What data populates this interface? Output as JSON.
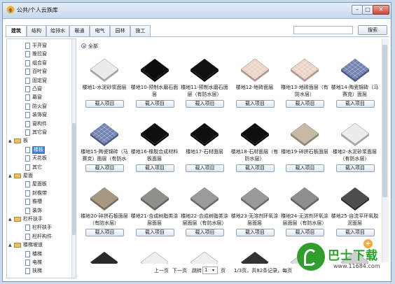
{
  "window": {
    "title": "公共/个人云族库"
  },
  "tabs": [
    "建筑",
    "结构",
    "给排水",
    "暖通",
    "电气",
    "园林",
    "施工"
  ],
  "search": {
    "placeholder": "",
    "button_label": "搜索"
  },
  "tree": [
    {
      "label": "平开窗",
      "level": 2,
      "kind": "doc",
      "expand": ""
    },
    {
      "label": "推拉窗",
      "level": 2,
      "kind": "doc",
      "expand": ""
    },
    {
      "label": "组合窗",
      "level": 2,
      "kind": "doc",
      "expand": ""
    },
    {
      "label": "百叶窗",
      "level": 2,
      "kind": "doc",
      "expand": ""
    },
    {
      "label": "固定窗",
      "level": 2,
      "kind": "doc",
      "expand": ""
    },
    {
      "label": "凸窗",
      "level": 2,
      "kind": "doc",
      "expand": ""
    },
    {
      "label": "幕窗",
      "level": 2,
      "kind": "doc",
      "expand": ""
    },
    {
      "label": "防火窗",
      "level": 2,
      "kind": "doc",
      "expand": ""
    },
    {
      "label": "装饰窗",
      "level": 2,
      "kind": "doc",
      "expand": ""
    },
    {
      "label": "窗构件",
      "level": 2,
      "kind": "doc",
      "expand": ""
    },
    {
      "label": "其它窗",
      "level": 2,
      "kind": "doc",
      "expand": ""
    },
    {
      "label": "板",
      "level": 1,
      "kind": "folder",
      "expand": "▲"
    },
    {
      "label": "楼板",
      "level": 2,
      "kind": "doc",
      "expand": "",
      "selected": true
    },
    {
      "label": "天花板",
      "level": 2,
      "kind": "doc",
      "expand": ""
    },
    {
      "label": "其它",
      "level": 2,
      "kind": "doc",
      "expand": ""
    },
    {
      "label": "屋面",
      "level": 1,
      "kind": "folder",
      "expand": "▲"
    },
    {
      "label": "屋面板",
      "level": 2,
      "kind": "doc",
      "expand": ""
    },
    {
      "label": "封檐带",
      "level": 2,
      "kind": "doc",
      "expand": ""
    },
    {
      "label": "檐槽",
      "level": 2,
      "kind": "doc",
      "expand": ""
    },
    {
      "label": "装饰",
      "level": 2,
      "kind": "doc",
      "expand": ""
    },
    {
      "label": "栏杆扶手",
      "level": 1,
      "kind": "folder",
      "expand": "▲"
    },
    {
      "label": "栏杆扶手",
      "level": 2,
      "kind": "doc",
      "expand": ""
    },
    {
      "label": "栏杆构件",
      "level": 2,
      "kind": "doc",
      "expand": ""
    },
    {
      "label": "楼梯坡道",
      "level": 1,
      "kind": "folder",
      "expand": "▲"
    },
    {
      "label": "楼梯",
      "level": 2,
      "kind": "doc",
      "expand": ""
    },
    {
      "label": "电梯",
      "level": 2,
      "kind": "doc",
      "expand": ""
    },
    {
      "label": "扶梯",
      "level": 2,
      "kind": "doc",
      "expand": ""
    }
  ],
  "filter": {
    "all_label": "全部"
  },
  "load_label": "载入项目",
  "items": [
    {
      "name": "楼地1-水泥砂浆面层",
      "top": "#ececec",
      "side": "#a9a9a9",
      "pattern": ""
    },
    {
      "name": "楼地10-预制水磨石面层",
      "top": "#0c0c0c",
      "side": "#000000",
      "pattern": ""
    },
    {
      "name": "楼地11-预制水磨石面层（有防水层）",
      "top": "#101010",
      "side": "#000000",
      "pattern": ""
    },
    {
      "name": "楼地12-地砖面层",
      "top": "#ecd2c7",
      "side": "#b39c92",
      "pattern": "grid"
    },
    {
      "name": "楼地13-地砖面层（有防水层）",
      "top": "#ecd2c7",
      "side": "#b39c92",
      "pattern": "grid"
    },
    {
      "name": "楼地14-陶瓷锦砖（马赛克）面层",
      "top": "#7283b3",
      "side": "#4a5785",
      "pattern": "grid"
    },
    {
      "name": "楼地15-陶瓷锦砖（马赛克）面层（有防水层）",
      "top": "#7283b3",
      "side": "#4a5785",
      "pattern": "grid"
    },
    {
      "name": "楼地16-橡胶合成材料板面层",
      "top": "#0f0f0f",
      "side": "#000000",
      "pattern": ""
    },
    {
      "name": "楼地17-石材面层",
      "top": "#0f0f0f",
      "side": "#000000",
      "pattern": ""
    },
    {
      "name": "楼地18-石材面层（有防水层）",
      "top": "#0f0f0f",
      "side": "#000000",
      "pattern": ""
    },
    {
      "name": "楼地19-碎拼石板面层",
      "top": "#c7b9a6",
      "side": "#948676",
      "pattern": ""
    },
    {
      "name": "楼地2-水泥砂浆面层（有防水层）",
      "top": "#ececec",
      "side": "#a9a9a9",
      "pattern": ""
    },
    {
      "name": "楼地20-碎拼石板面层（有防水层）",
      "top": "#a79882",
      "side": "#776a58",
      "pattern": ""
    },
    {
      "name": "楼地21-合成树脂类涂层面层",
      "top": "#8e9189",
      "side": "#5f625a",
      "pattern": ""
    },
    {
      "name": "楼地22-合成树脂类涂层面层（有防水层）",
      "top": "#9a9c98",
      "side": "#6a6c68",
      "pattern": ""
    },
    {
      "name": "楼地23-无溶剂环氧涂层面层",
      "top": "#9a9a9a",
      "side": "#6b6b6b",
      "pattern": ""
    },
    {
      "name": "楼地24-无溶剂环氧涂层面层（有防水层）",
      "top": "#8e8e8e",
      "side": "#5f5f5f",
      "pattern": ""
    },
    {
      "name": "楼地25-自流平环氧胶泥面层",
      "top": "#4d4d4d",
      "side": "#2a2a2a",
      "pattern": ""
    }
  ],
  "pager": {
    "prev": "上一页",
    "next": "下一页",
    "jump": "跳转",
    "page_value": "1",
    "page_unit": "页",
    "summary": "1/3页，共82条记录，每页"
  },
  "watermark": {
    "brand": "巴士下载",
    "url": "www.11684.com"
  }
}
